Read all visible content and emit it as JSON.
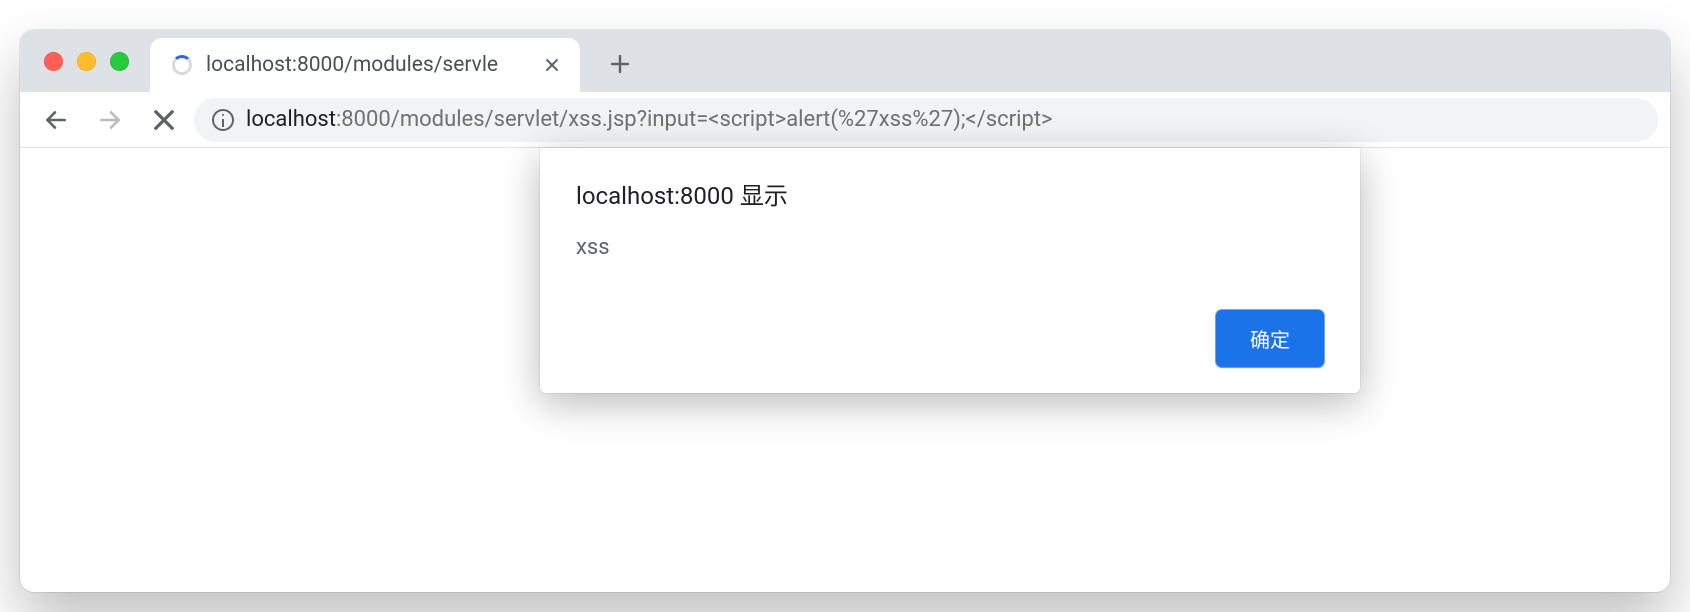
{
  "tab": {
    "title": "localhost:8000/modules/servle"
  },
  "url": {
    "host": "localhost",
    "rest": ":8000/modules/servlet/xss.jsp?input=<script>alert(%27xss%27);</script>"
  },
  "alert": {
    "title": "localhost:8000 显示",
    "message": "xss",
    "ok_label": "确定"
  }
}
